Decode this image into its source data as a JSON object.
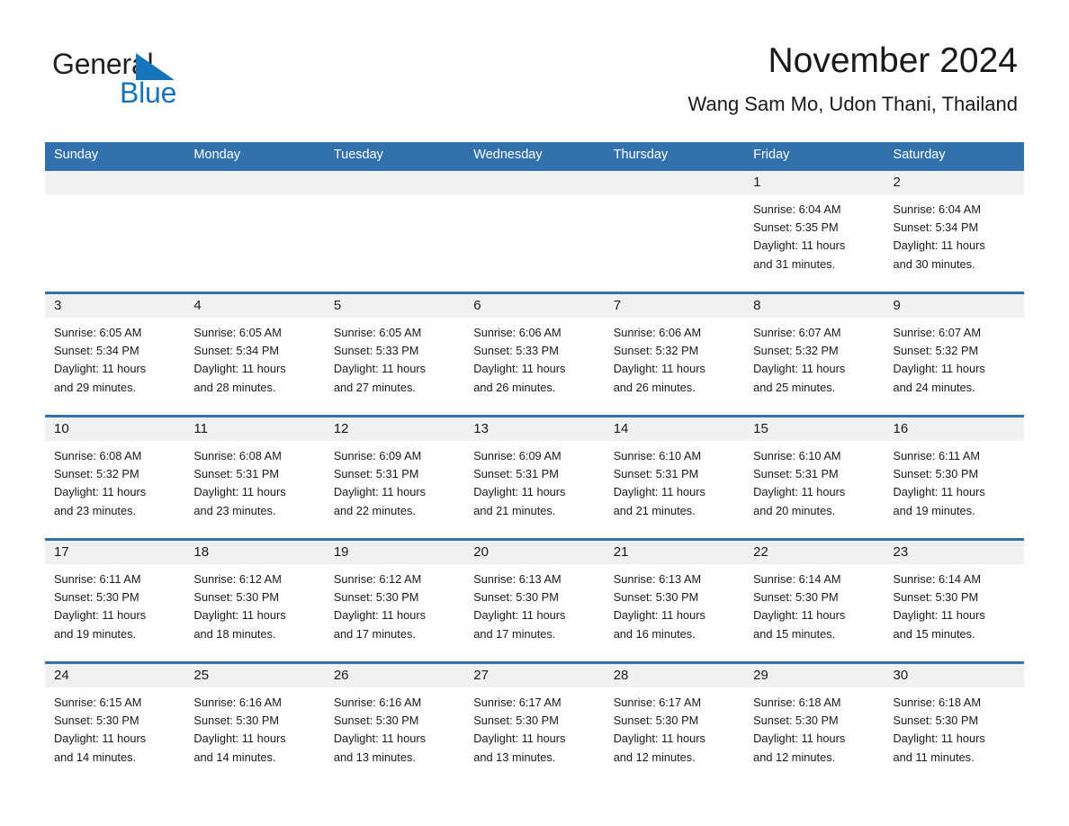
{
  "brand": {
    "name_part1": "General",
    "name_part2": "Blue",
    "triangle_icon": "triangle-icon",
    "color_dark": "#231f20",
    "color_blue": "#1574bb"
  },
  "header": {
    "title": "November 2024",
    "subtitle": "Wang Sam Mo, Udon Thani, Thailand"
  },
  "theme": {
    "header_blue": "#3271ab",
    "row_separator_blue": "#3271ab",
    "daynum_band_gray": "#f1f1f1",
    "cell_white": "#ffffff",
    "text_dark": "#1a1a1a",
    "header_text": "#ffffff"
  },
  "calendar": {
    "weekday_headers": [
      "Sunday",
      "Monday",
      "Tuesday",
      "Wednesday",
      "Thursday",
      "Friday",
      "Saturday"
    ],
    "labels": {
      "sunrise_prefix": "Sunrise:",
      "sunset_prefix": "Sunset:",
      "daylight_prefix": "Daylight:"
    },
    "weeks": [
      [
        {
          "day": "",
          "line1": "",
          "line2": "",
          "line3": "",
          "line4": "",
          "empty": true
        },
        {
          "day": "",
          "line1": "",
          "line2": "",
          "line3": "",
          "line4": "",
          "empty": true
        },
        {
          "day": "",
          "line1": "",
          "line2": "",
          "line3": "",
          "line4": "",
          "empty": true
        },
        {
          "day": "",
          "line1": "",
          "line2": "",
          "line3": "",
          "line4": "",
          "empty": true
        },
        {
          "day": "",
          "line1": "",
          "line2": "",
          "line3": "",
          "line4": "",
          "empty": true
        },
        {
          "day": "1",
          "line1": "Sunrise: 6:04 AM",
          "line2": "Sunset: 5:35 PM",
          "line3": "Daylight: 11 hours",
          "line4": "and 31 minutes.",
          "empty": false
        },
        {
          "day": "2",
          "line1": "Sunrise: 6:04 AM",
          "line2": "Sunset: 5:34 PM",
          "line3": "Daylight: 11 hours",
          "line4": "and 30 minutes.",
          "empty": false
        }
      ],
      [
        {
          "day": "3",
          "line1": "Sunrise: 6:05 AM",
          "line2": "Sunset: 5:34 PM",
          "line3": "Daylight: 11 hours",
          "line4": "and 29 minutes.",
          "empty": false
        },
        {
          "day": "4",
          "line1": "Sunrise: 6:05 AM",
          "line2": "Sunset: 5:34 PM",
          "line3": "Daylight: 11 hours",
          "line4": "and 28 minutes.",
          "empty": false
        },
        {
          "day": "5",
          "line1": "Sunrise: 6:05 AM",
          "line2": "Sunset: 5:33 PM",
          "line3": "Daylight: 11 hours",
          "line4": "and 27 minutes.",
          "empty": false
        },
        {
          "day": "6",
          "line1": "Sunrise: 6:06 AM",
          "line2": "Sunset: 5:33 PM",
          "line3": "Daylight: 11 hours",
          "line4": "and 26 minutes.",
          "empty": false
        },
        {
          "day": "7",
          "line1": "Sunrise: 6:06 AM",
          "line2": "Sunset: 5:32 PM",
          "line3": "Daylight: 11 hours",
          "line4": "and 26 minutes.",
          "empty": false
        },
        {
          "day": "8",
          "line1": "Sunrise: 6:07 AM",
          "line2": "Sunset: 5:32 PM",
          "line3": "Daylight: 11 hours",
          "line4": "and 25 minutes.",
          "empty": false
        },
        {
          "day": "9",
          "line1": "Sunrise: 6:07 AM",
          "line2": "Sunset: 5:32 PM",
          "line3": "Daylight: 11 hours",
          "line4": "and 24 minutes.",
          "empty": false
        }
      ],
      [
        {
          "day": "10",
          "line1": "Sunrise: 6:08 AM",
          "line2": "Sunset: 5:32 PM",
          "line3": "Daylight: 11 hours",
          "line4": "and 23 minutes.",
          "empty": false
        },
        {
          "day": "11",
          "line1": "Sunrise: 6:08 AM",
          "line2": "Sunset: 5:31 PM",
          "line3": "Daylight: 11 hours",
          "line4": "and 23 minutes.",
          "empty": false
        },
        {
          "day": "12",
          "line1": "Sunrise: 6:09 AM",
          "line2": "Sunset: 5:31 PM",
          "line3": "Daylight: 11 hours",
          "line4": "and 22 minutes.",
          "empty": false
        },
        {
          "day": "13",
          "line1": "Sunrise: 6:09 AM",
          "line2": "Sunset: 5:31 PM",
          "line3": "Daylight: 11 hours",
          "line4": "and 21 minutes.",
          "empty": false
        },
        {
          "day": "14",
          "line1": "Sunrise: 6:10 AM",
          "line2": "Sunset: 5:31 PM",
          "line3": "Daylight: 11 hours",
          "line4": "and 21 minutes.",
          "empty": false
        },
        {
          "day": "15",
          "line1": "Sunrise: 6:10 AM",
          "line2": "Sunset: 5:31 PM",
          "line3": "Daylight: 11 hours",
          "line4": "and 20 minutes.",
          "empty": false
        },
        {
          "day": "16",
          "line1": "Sunrise: 6:11 AM",
          "line2": "Sunset: 5:30 PM",
          "line3": "Daylight: 11 hours",
          "line4": "and 19 minutes.",
          "empty": false
        }
      ],
      [
        {
          "day": "17",
          "line1": "Sunrise: 6:11 AM",
          "line2": "Sunset: 5:30 PM",
          "line3": "Daylight: 11 hours",
          "line4": "and 19 minutes.",
          "empty": false
        },
        {
          "day": "18",
          "line1": "Sunrise: 6:12 AM",
          "line2": "Sunset: 5:30 PM",
          "line3": "Daylight: 11 hours",
          "line4": "and 18 minutes.",
          "empty": false
        },
        {
          "day": "19",
          "line1": "Sunrise: 6:12 AM",
          "line2": "Sunset: 5:30 PM",
          "line3": "Daylight: 11 hours",
          "line4": "and 17 minutes.",
          "empty": false
        },
        {
          "day": "20",
          "line1": "Sunrise: 6:13 AM",
          "line2": "Sunset: 5:30 PM",
          "line3": "Daylight: 11 hours",
          "line4": "and 17 minutes.",
          "empty": false
        },
        {
          "day": "21",
          "line1": "Sunrise: 6:13 AM",
          "line2": "Sunset: 5:30 PM",
          "line3": "Daylight: 11 hours",
          "line4": "and 16 minutes.",
          "empty": false
        },
        {
          "day": "22",
          "line1": "Sunrise: 6:14 AM",
          "line2": "Sunset: 5:30 PM",
          "line3": "Daylight: 11 hours",
          "line4": "and 15 minutes.",
          "empty": false
        },
        {
          "day": "23",
          "line1": "Sunrise: 6:14 AM",
          "line2": "Sunset: 5:30 PM",
          "line3": "Daylight: 11 hours",
          "line4": "and 15 minutes.",
          "empty": false
        }
      ],
      [
        {
          "day": "24",
          "line1": "Sunrise: 6:15 AM",
          "line2": "Sunset: 5:30 PM",
          "line3": "Daylight: 11 hours",
          "line4": "and 14 minutes.",
          "empty": false
        },
        {
          "day": "25",
          "line1": "Sunrise: 6:16 AM",
          "line2": "Sunset: 5:30 PM",
          "line3": "Daylight: 11 hours",
          "line4": "and 14 minutes.",
          "empty": false
        },
        {
          "day": "26",
          "line1": "Sunrise: 6:16 AM",
          "line2": "Sunset: 5:30 PM",
          "line3": "Daylight: 11 hours",
          "line4": "and 13 minutes.",
          "empty": false
        },
        {
          "day": "27",
          "line1": "Sunrise: 6:17 AM",
          "line2": "Sunset: 5:30 PM",
          "line3": "Daylight: 11 hours",
          "line4": "and 13 minutes.",
          "empty": false
        },
        {
          "day": "28",
          "line1": "Sunrise: 6:17 AM",
          "line2": "Sunset: 5:30 PM",
          "line3": "Daylight: 11 hours",
          "line4": "and 12 minutes.",
          "empty": false
        },
        {
          "day": "29",
          "line1": "Sunrise: 6:18 AM",
          "line2": "Sunset: 5:30 PM",
          "line3": "Daylight: 11 hours",
          "line4": "and 12 minutes.",
          "empty": false
        },
        {
          "day": "30",
          "line1": "Sunrise: 6:18 AM",
          "line2": "Sunset: 5:30 PM",
          "line3": "Daylight: 11 hours",
          "line4": "and 11 minutes.",
          "empty": false
        }
      ]
    ]
  }
}
